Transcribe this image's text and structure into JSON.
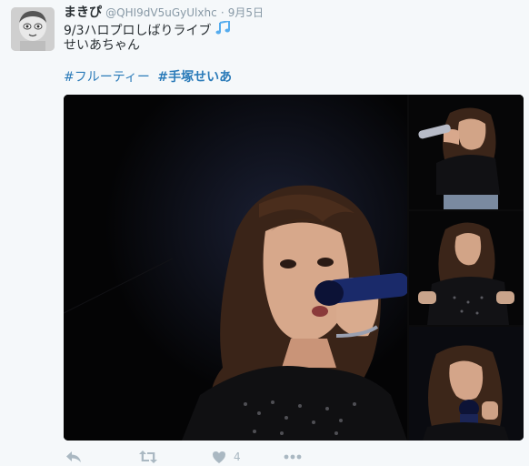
{
  "tweet": {
    "display_name": "まきぴ",
    "handle": "@QHI9dV5uGyUlxhc",
    "separator": "·",
    "timestamp": "9月5日",
    "text_line1": "9/3ハロプロしばりライブ",
    "text_icon": "music-note-icon",
    "text_line2": "せいあちゃん",
    "hashtags": [
      "#フルーティー",
      "#手塚せいあ"
    ]
  },
  "actions": {
    "reply_icon": "reply-icon",
    "retweet_icon": "retweet-icon",
    "like_icon": "heart-icon",
    "like_count": "4",
    "more_icon": "more-icon"
  },
  "colors": {
    "background": "#f5f8fa",
    "link": "#2b7bb9",
    "muted": "#8899a6",
    "icon": "#aab8c2",
    "accent": "#55acee"
  }
}
